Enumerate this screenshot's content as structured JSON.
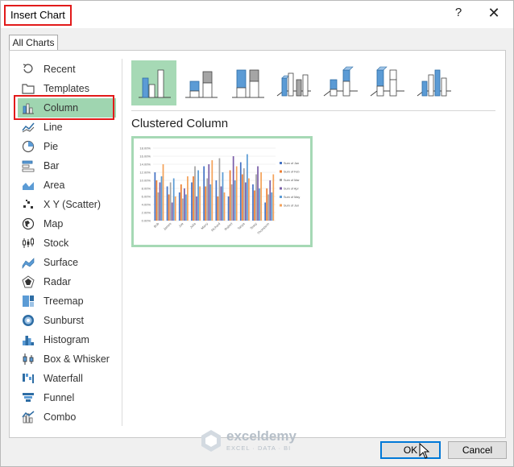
{
  "dialog": {
    "title": "Insert Chart",
    "help_glyph": "?",
    "close_glyph": "✕",
    "tab_label": "All Charts"
  },
  "sidebar": {
    "items": [
      {
        "label": "Recent",
        "icon": "recent-icon"
      },
      {
        "label": "Templates",
        "icon": "templates-icon"
      },
      {
        "label": "Column",
        "icon": "column-chart-icon",
        "selected": true
      },
      {
        "label": "Line",
        "icon": "line-chart-icon"
      },
      {
        "label": "Pie",
        "icon": "pie-chart-icon"
      },
      {
        "label": "Bar",
        "icon": "bar-chart-icon"
      },
      {
        "label": "Area",
        "icon": "area-chart-icon"
      },
      {
        "label": "X Y (Scatter)",
        "icon": "scatter-chart-icon"
      },
      {
        "label": "Map",
        "icon": "map-chart-icon"
      },
      {
        "label": "Stock",
        "icon": "stock-chart-icon"
      },
      {
        "label": "Surface",
        "icon": "surface-chart-icon"
      },
      {
        "label": "Radar",
        "icon": "radar-chart-icon"
      },
      {
        "label": "Treemap",
        "icon": "treemap-chart-icon"
      },
      {
        "label": "Sunburst",
        "icon": "sunburst-chart-icon"
      },
      {
        "label": "Histogram",
        "icon": "histogram-chart-icon"
      },
      {
        "label": "Box & Whisker",
        "icon": "box-whisker-chart-icon"
      },
      {
        "label": "Waterfall",
        "icon": "waterfall-chart-icon"
      },
      {
        "label": "Funnel",
        "icon": "funnel-chart-icon"
      },
      {
        "label": "Combo",
        "icon": "combo-chart-icon"
      }
    ]
  },
  "subtypes": [
    {
      "name": "clustered-column",
      "active": true
    },
    {
      "name": "stacked-column"
    },
    {
      "name": "100-stacked-column"
    },
    {
      "name": "3d-clustered-column"
    },
    {
      "name": "3d-stacked-column"
    },
    {
      "name": "3d-100-stacked-column"
    },
    {
      "name": "3d-column"
    }
  ],
  "selected_chart_label": "Clustered Column",
  "preview": {
    "chart_data": {
      "type": "bar",
      "categories": [
        "Bob",
        "James",
        "Joe",
        "Julia",
        "Marry",
        "Richard",
        "Robert",
        "Tanya",
        "Tessy",
        "Thompson"
      ],
      "series": [
        {
          "name": "Sum of Jan",
          "color": "#4472c4",
          "values": [
            12.0,
            8.5,
            7.0,
            9.5,
            13.5,
            10.0,
            6.0,
            14.5,
            9.0,
            4.5
          ]
        },
        {
          "name": "Sum of Feb",
          "color": "#ed7d31",
          "values": [
            10.0,
            6.5,
            9.0,
            11.0,
            8.5,
            6.0,
            12.5,
            11.5,
            7.5,
            8.0
          ]
        },
        {
          "name": "Sum of Mar",
          "color": "#a5a5a5",
          "values": [
            7.0,
            9.5,
            5.5,
            13.5,
            10.5,
            15.5,
            9.0,
            13.0,
            11.5,
            6.5
          ]
        },
        {
          "name": "Sum of Apr",
          "color": "#7a5ea8",
          "values": [
            9.5,
            4.5,
            8.0,
            6.0,
            14.0,
            8.5,
            16.0,
            9.5,
            13.5,
            10.0
          ]
        },
        {
          "name": "Sum of May",
          "color": "#5b9bd5",
          "values": [
            11.0,
            10.5,
            6.5,
            12.5,
            9.0,
            12.0,
            10.0,
            16.5,
            8.0,
            7.0
          ]
        },
        {
          "name": "Sum of Jun",
          "color": "#f4a259",
          "values": [
            14.0,
            6.0,
            11.0,
            8.5,
            15.0,
            7.0,
            13.5,
            10.5,
            12.0,
            11.5
          ]
        }
      ],
      "y_ticks": [
        "0.00%",
        "2.00%",
        "4.00%",
        "6.00%",
        "8.00%",
        "10.00%",
        "12.00%",
        "14.00%",
        "16.00%",
        "18.00%"
      ],
      "ylim": [
        0,
        18
      ],
      "legend_position": "right",
      "grid": true
    }
  },
  "buttons": {
    "ok": "OK",
    "cancel": "Cancel"
  },
  "watermark": {
    "name": "exceldemy",
    "tagline": "EXCEL · DATA · BI"
  }
}
